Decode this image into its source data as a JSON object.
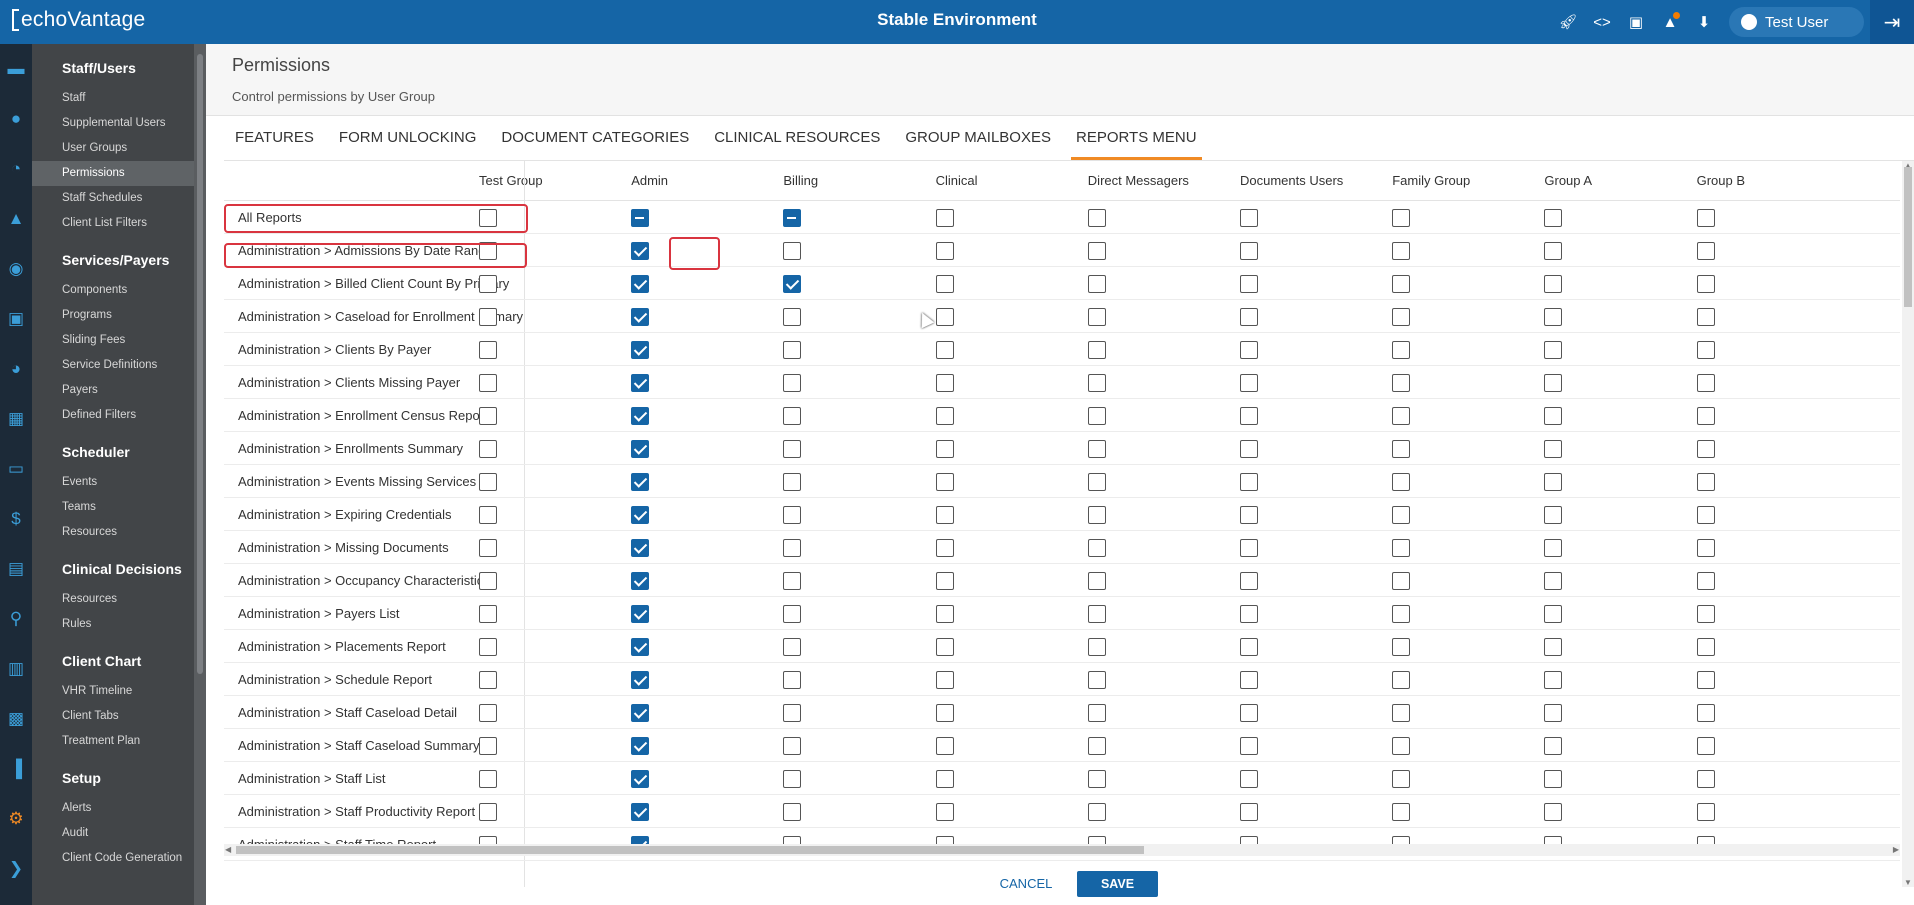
{
  "topbar": {
    "logo_text": "echoVantage",
    "env_title": "Stable Environment",
    "icons": [
      "rocket-icon",
      "code-icon",
      "lifebuoy-icon",
      "bell-icon",
      "download-icon",
      "mail-icon",
      "chart-icon",
      "help-icon"
    ],
    "user_name": "Test User"
  },
  "sidenav": {
    "sections": [
      {
        "title": "Staff/Users",
        "items": [
          "Staff",
          "Supplemental Users",
          "User Groups",
          "Permissions",
          "Staff Schedules",
          "Client List Filters"
        ]
      },
      {
        "title": "Services/Payers",
        "items": [
          "Components",
          "Programs",
          "Sliding Fees",
          "Service Definitions",
          "Payers",
          "Defined Filters"
        ]
      },
      {
        "title": "Scheduler",
        "items": [
          "Events",
          "Teams",
          "Resources"
        ]
      },
      {
        "title": "Clinical Decisions",
        "items": [
          "Resources",
          "Rules"
        ]
      },
      {
        "title": "Client Chart",
        "items": [
          "VHR Timeline",
          "Client Tabs",
          "Treatment Plan"
        ]
      },
      {
        "title": "Setup",
        "items": [
          "Alerts",
          "Audit",
          "Client Code Generation"
        ]
      }
    ],
    "active_item": "Permissions"
  },
  "page": {
    "title": "Permissions",
    "subtitle": "Control permissions by User Group"
  },
  "tabs": [
    "FEATURES",
    "FORM UNLOCKING",
    "DOCUMENT CATEGORIES",
    "CLINICAL RESOURCES",
    "GROUP MAILBOXES",
    "REPORTS MENU"
  ],
  "active_tab": "REPORTS MENU",
  "columns": [
    "Test Group",
    "Admin",
    "Billing",
    "Clinical",
    "Direct Messagers",
    "Documents Users",
    "Family Group",
    "Group A",
    "Group B"
  ],
  "rows": [
    {
      "name": "All Reports",
      "states": [
        "u",
        "p",
        "p",
        "u",
        "u",
        "u",
        "u",
        "u",
        "u"
      ]
    },
    {
      "name": "Administration > Admissions By Date Range",
      "states": [
        "u",
        "c",
        "u",
        "u",
        "u",
        "u",
        "u",
        "u",
        "u"
      ]
    },
    {
      "name": "Administration > Billed Client Count By Primary",
      "states": [
        "u",
        "c",
        "c",
        "u",
        "u",
        "u",
        "u",
        "u",
        "u"
      ]
    },
    {
      "name": "Administration > Caseload for Enrollment Primary",
      "states": [
        "u",
        "c",
        "u",
        "u",
        "u",
        "u",
        "u",
        "u",
        "u"
      ]
    },
    {
      "name": "Administration > Clients By Payer",
      "states": [
        "u",
        "c",
        "u",
        "u",
        "u",
        "u",
        "u",
        "u",
        "u"
      ]
    },
    {
      "name": "Administration > Clients Missing Payer",
      "states": [
        "u",
        "c",
        "u",
        "u",
        "u",
        "u",
        "u",
        "u",
        "u"
      ]
    },
    {
      "name": "Administration > Enrollment Census Report",
      "states": [
        "u",
        "c",
        "u",
        "u",
        "u",
        "u",
        "u",
        "u",
        "u"
      ]
    },
    {
      "name": "Administration > Enrollments Summary",
      "states": [
        "u",
        "c",
        "u",
        "u",
        "u",
        "u",
        "u",
        "u",
        "u"
      ]
    },
    {
      "name": "Administration > Events Missing Services",
      "states": [
        "u",
        "c",
        "u",
        "u",
        "u",
        "u",
        "u",
        "u",
        "u"
      ]
    },
    {
      "name": "Administration > Expiring Credentials",
      "states": [
        "u",
        "c",
        "u",
        "u",
        "u",
        "u",
        "u",
        "u",
        "u"
      ]
    },
    {
      "name": "Administration > Missing Documents",
      "states": [
        "u",
        "c",
        "u",
        "u",
        "u",
        "u",
        "u",
        "u",
        "u"
      ]
    },
    {
      "name": "Administration > Occupancy Characteristics",
      "states": [
        "u",
        "c",
        "u",
        "u",
        "u",
        "u",
        "u",
        "u",
        "u"
      ]
    },
    {
      "name": "Administration > Payers List",
      "states": [
        "u",
        "c",
        "u",
        "u",
        "u",
        "u",
        "u",
        "u",
        "u"
      ]
    },
    {
      "name": "Administration > Placements Report",
      "states": [
        "u",
        "c",
        "u",
        "u",
        "u",
        "u",
        "u",
        "u",
        "u"
      ]
    },
    {
      "name": "Administration > Schedule Report",
      "states": [
        "u",
        "c",
        "u",
        "u",
        "u",
        "u",
        "u",
        "u",
        "u"
      ]
    },
    {
      "name": "Administration > Staff Caseload Detail",
      "states": [
        "u",
        "c",
        "u",
        "u",
        "u",
        "u",
        "u",
        "u",
        "u"
      ]
    },
    {
      "name": "Administration > Staff Caseload Summary",
      "states": [
        "u",
        "c",
        "u",
        "u",
        "u",
        "u",
        "u",
        "u",
        "u"
      ]
    },
    {
      "name": "Administration > Staff List",
      "states": [
        "u",
        "c",
        "u",
        "u",
        "u",
        "u",
        "u",
        "u",
        "u"
      ]
    },
    {
      "name": "Administration > Staff Productivity Report",
      "states": [
        "u",
        "c",
        "u",
        "u",
        "u",
        "u",
        "u",
        "u",
        "u"
      ]
    },
    {
      "name": "Administration > Staff Time Report",
      "states": [
        "u",
        "c",
        "u",
        "u",
        "u",
        "u",
        "u",
        "u",
        "u"
      ]
    }
  ],
  "buttons": {
    "cancel": "CANCEL",
    "save": "SAVE"
  },
  "colors": {
    "brand": "#1565a6",
    "accent": "#f08a24",
    "highlight": "#d9343f"
  }
}
